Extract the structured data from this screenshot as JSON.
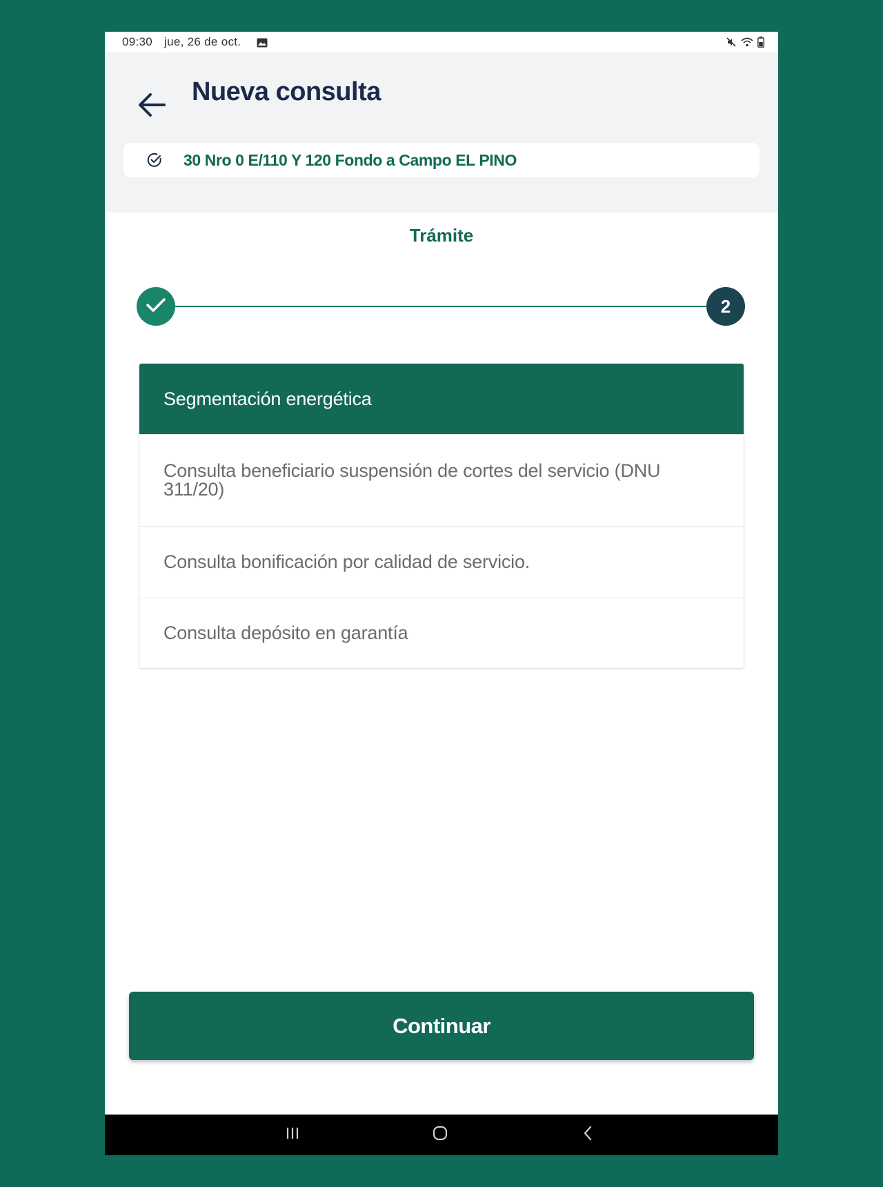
{
  "status_bar": {
    "time": "09:30",
    "date": "jue, 26 de oct.",
    "icons": [
      "image-icon",
      "mute-icon",
      "wifi-icon",
      "battery-icon"
    ]
  },
  "header": {
    "title": "Nueva consulta",
    "back_icon": "arrow-left-icon",
    "address": "30 Nro 0 E/110 Y 120 Fondo a Campo EL PINO",
    "address_icon": "check-circle-icon"
  },
  "step": {
    "title": "Trámite",
    "completed_icon": "check-icon",
    "current_number": "2"
  },
  "options": [
    {
      "label": "Segmentación energética",
      "selected": true
    },
    {
      "label": "Consulta beneficiario suspensión de cortes del servicio (DNU 311/20)",
      "selected": false
    },
    {
      "label": "Consulta bonificación por calidad de servicio.",
      "selected": false
    },
    {
      "label": "Consulta depósito en garantía",
      "selected": false
    }
  ],
  "actions": {
    "continue_label": "Continuar"
  },
  "nav_bar": {
    "icons": [
      "recent-apps-icon",
      "home-icon",
      "back-icon"
    ]
  },
  "colors": {
    "brand": "#126a56",
    "background": "#0e6b5a",
    "title": "#1b2a4a",
    "step_current": "#1a4450"
  }
}
